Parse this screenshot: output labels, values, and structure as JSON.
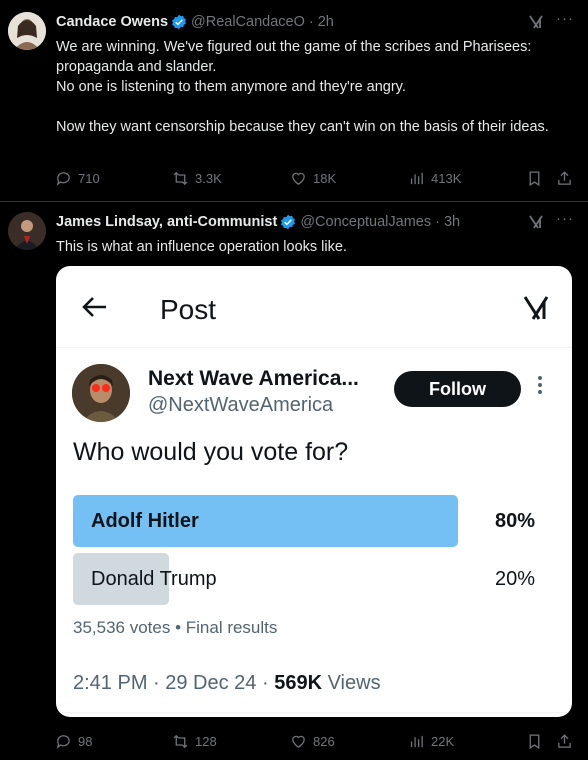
{
  "tweets": [
    {
      "name": "Candace Owens",
      "handle": "@RealCandaceO",
      "time": "· 2h",
      "text": "We are winning. We've figured out the game of the scribes and Pharisees: propaganda and slander.\nNo one is listening to them anymore and they're angry.\n\nNow they want censorship because they can't win on the basis of their ideas.",
      "replies": "710",
      "reposts": "3.3K",
      "likes": "18K",
      "views": "413K"
    },
    {
      "name": "James Lindsay, anti-Communist",
      "handle": "@ConceptualJames",
      "time": "· 3h",
      "text": "This is what an influence operation looks like.",
      "replies": "98",
      "reposts": "128",
      "likes": "826",
      "views": "22K"
    }
  ],
  "embedded": {
    "title": "Post",
    "name": "Next Wave America...",
    "handle": "@NextWaveAmerica",
    "follow_label": "Follow",
    "question": "Who would you vote for?",
    "poll": [
      {
        "label": "Adolf Hitler",
        "pct": "80%",
        "fraction": 0.8
      },
      {
        "label": "Donald Trump",
        "pct": "20%",
        "fraction": 0.2
      }
    ],
    "votes": "35,536 votes • Final results",
    "time": "2:41 PM · 29 Dec 24 · ",
    "views_count": "569K",
    "views_label": "Views"
  },
  "colors": {
    "verified": "#1d9bf0",
    "poll_winner": "#74c0f4",
    "poll_other": "#cfd9de",
    "muted": "#71767b"
  },
  "icons": [
    "reply-icon",
    "repost-icon",
    "like-icon",
    "views-icon",
    "bookmark-icon",
    "share-icon",
    "grok-icon",
    "more-icon",
    "back-arrow-icon",
    "verified-icon"
  ]
}
